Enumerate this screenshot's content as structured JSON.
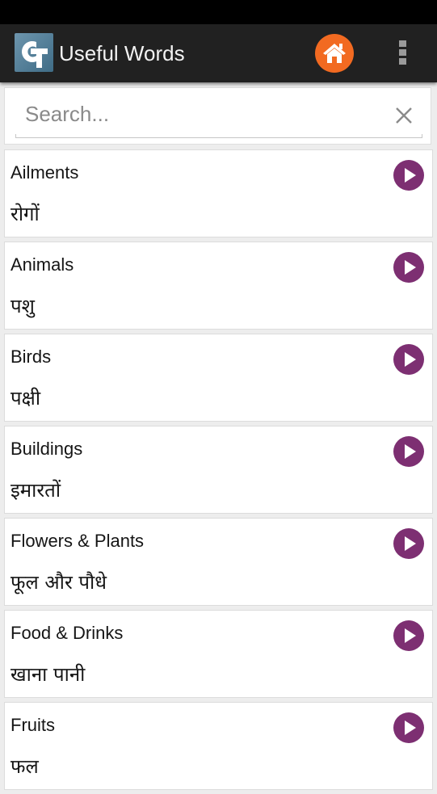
{
  "app": {
    "title": "Useful Words",
    "logo_icon": "app-logo-icon",
    "home_icon": "home-icon",
    "overflow_icon": "more-vertical-icon",
    "colors": {
      "action_bar": "#212121",
      "home_button": "#f26a21",
      "play_button": "#7d2f72",
      "background": "#ededed"
    }
  },
  "search": {
    "placeholder": "Search...",
    "value": "",
    "clear_icon": "close-icon"
  },
  "categories": [
    {
      "title": "Ailments",
      "translation": "रोगों"
    },
    {
      "title": "Animals",
      "translation": "पशु"
    },
    {
      "title": "Birds",
      "translation": "पक्षी"
    },
    {
      "title": "Buildings",
      "translation": "इमारतों"
    },
    {
      "title": "Flowers & Plants",
      "translation": "फूल और पौधे"
    },
    {
      "title": "Food & Drinks",
      "translation": "खाना पानी"
    },
    {
      "title": "Fruits",
      "translation": "फल"
    }
  ]
}
